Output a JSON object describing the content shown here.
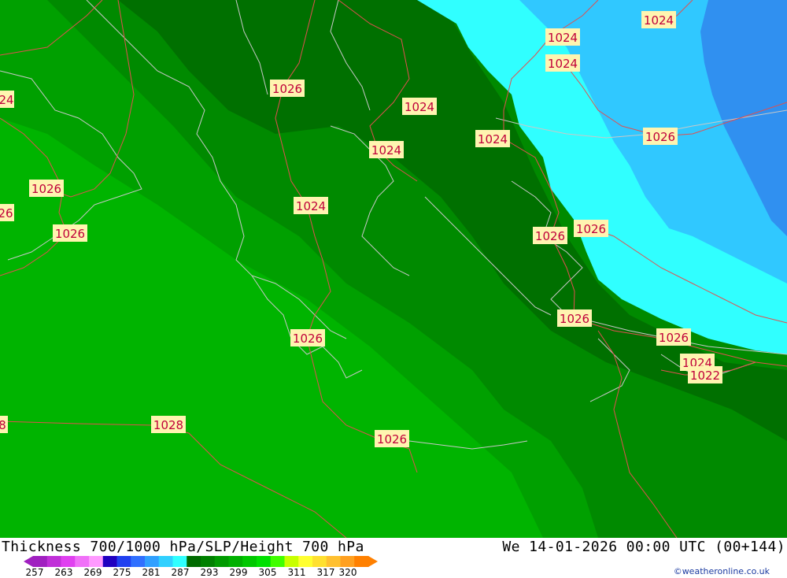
{
  "product_title": "Thickness 700/1000 hPa/SLP/Height 700 hPa",
  "valid_time": "We 14-01-2026 00:00 UTC (00+144)",
  "credit": "©weatheronline.co.uk",
  "legend": {
    "tick_labels": [
      "257",
      "263",
      "269",
      "275",
      "281",
      "287",
      "293",
      "299",
      "305",
      "311",
      "317",
      "320"
    ],
    "colors": [
      "#a020c0",
      "#c030d8",
      "#e040f0",
      "#f070f8",
      "#ff99ff",
      "#2000c0",
      "#2040f0",
      "#3070ff",
      "#30a0ff",
      "#30d0ff",
      "#30ffff",
      "#006a00",
      "#008000",
      "#009a00",
      "#00b000",
      "#00c800",
      "#00e000",
      "#40ff00",
      "#c8ff00",
      "#ffff30",
      "#ffe030",
      "#ffc030",
      "#ffa020",
      "#ff8000"
    ]
  },
  "colors": {
    "thickness_darkest": "#007000",
    "thickness_dark": "#008a00",
    "thickness_mid": "#00a000",
    "thickness_light": "#00b400",
    "cold_cyan": "#30ffff",
    "cold_lightblue": "#30c8ff",
    "cold_blue": "#3090f0",
    "isobar_line": "#e05050",
    "coastline": "#c8c8c8",
    "label_fill": "#fff4b0",
    "label_text": "#c0003a"
  },
  "isobar_labels": [
    {
      "id": "l1",
      "text": "1024"
    },
    {
      "id": "l2",
      "text": "1024"
    },
    {
      "id": "l3",
      "text": "1024"
    },
    {
      "id": "l4",
      "text": "1026"
    },
    {
      "id": "l5",
      "text": "1024"
    },
    {
      "id": "l6",
      "text": "1024"
    },
    {
      "id": "l7",
      "text": "1026"
    },
    {
      "id": "l8",
      "text": "1024"
    },
    {
      "id": "l9",
      "text": "24"
    },
    {
      "id": "l10",
      "text": "1026"
    },
    {
      "id": "l11",
      "text": "26"
    },
    {
      "id": "l12",
      "text": "1026"
    },
    {
      "id": "l13",
      "text": "1024"
    },
    {
      "id": "l14",
      "text": "1026"
    },
    {
      "id": "l15",
      "text": "1026"
    },
    {
      "id": "l16",
      "text": "1026"
    },
    {
      "id": "l17",
      "text": "1026"
    },
    {
      "id": "l18",
      "text": "1026"
    },
    {
      "id": "l19",
      "text": "1024"
    },
    {
      "id": "l20",
      "text": "1022"
    },
    {
      "id": "l21",
      "text": "1028"
    },
    {
      "id": "l22",
      "text": "1026"
    },
    {
      "id": "l23",
      "text": "8"
    }
  ]
}
